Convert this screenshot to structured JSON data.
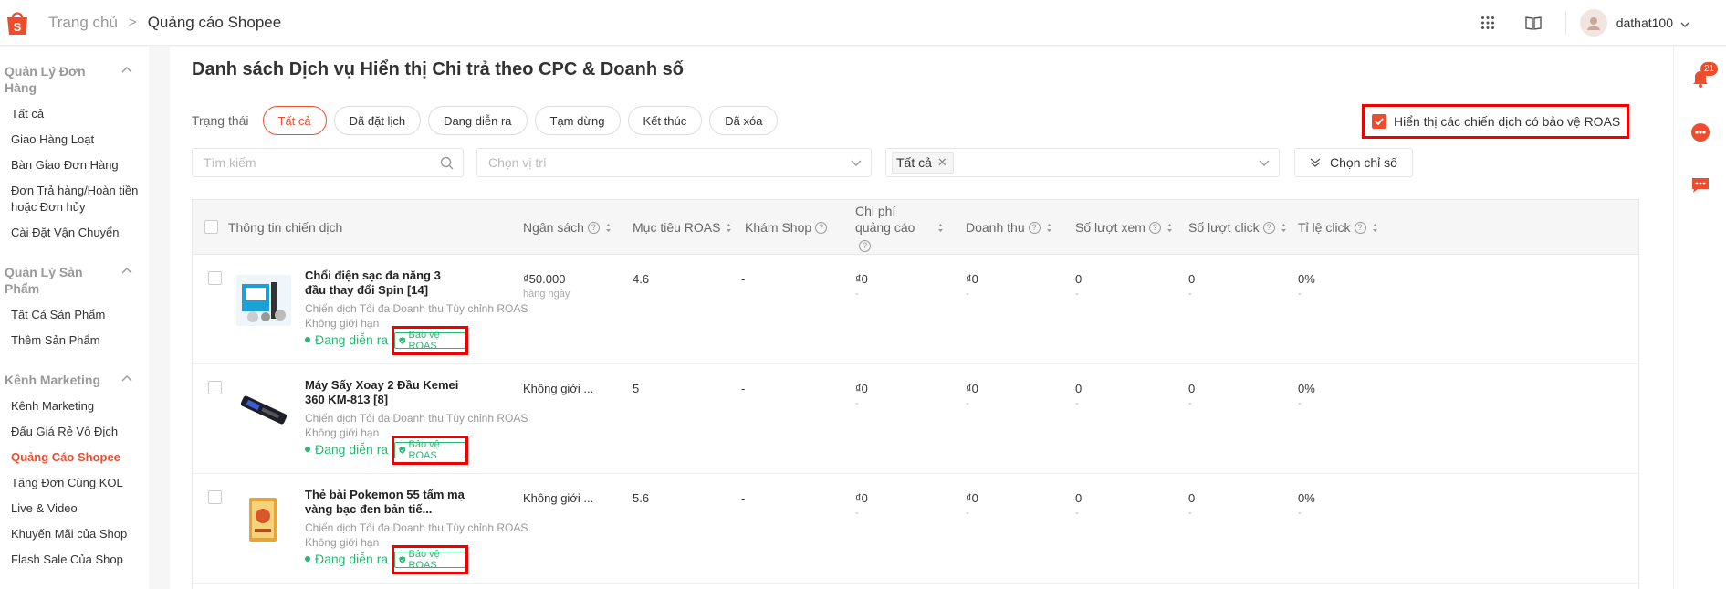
{
  "breadcrumb": {
    "home": "Trang chủ",
    "separator": ">",
    "current": "Quảng cáo Shopee"
  },
  "header": {
    "username": "dathat100",
    "notification_count": "21"
  },
  "sidebar": {
    "groups": [
      {
        "title": "Quản Lý Đơn Hàng",
        "items": [
          "Tất cả",
          "Giao Hàng Loạt",
          "Bàn Giao Đơn Hàng",
          "Đơn Trả hàng/Hoàn tiền hoặc Đơn hủy",
          "Cài Đặt Vận Chuyển"
        ]
      },
      {
        "title": "Quản Lý Sản Phẩm",
        "items": [
          "Tất Cả Sản Phẩm",
          "Thêm Sản Phẩm"
        ]
      },
      {
        "title": "Kênh Marketing",
        "items": [
          "Kênh Marketing",
          "Đấu Giá Rẻ Vô Địch",
          "Quảng Cáo Shopee",
          "Tăng Đơn Cùng KOL",
          "Live & Video",
          "Khuyến Mãi của Shop",
          "Flash Sale Của Shop"
        ]
      }
    ],
    "active_item": "Quảng Cáo Shopee"
  },
  "page": {
    "title": "Danh sách Dịch vụ Hiển thị Chi trả theo CPC & Doanh số"
  },
  "status_filter": {
    "label": "Trạng thái",
    "chips": [
      "Tất cả",
      "Đã đặt lịch",
      "Đang diễn ra",
      "Tạm dừng",
      "Kết thúc",
      "Đã xóa"
    ],
    "active": "Tất cả"
  },
  "roas_toggle": {
    "label": "Hiển thị các chiến dịch có bảo vệ ROAS",
    "checked": true
  },
  "filters": {
    "search_placeholder": "Tìm kiếm",
    "position_placeholder": "Chọn vị trí",
    "selected_tag": "Tất cả",
    "metric_button": "Chọn chỉ số"
  },
  "table": {
    "columns": [
      "Thông tin chiến dịch",
      "Ngân sách",
      "Mục tiêu ROAS",
      "Khám Shop",
      "Chi phí quảng cáo",
      "Doanh thu",
      "Số lượt xem",
      "Số lượt click",
      "Tỉ lệ click"
    ],
    "rows": [
      {
        "name": "Chổi điện sạc đa năng 3 đầu thay đổi Spin [14]",
        "type": "Chiến dịch Tối đa Doanh thu Tùy chỉnh ROAS",
        "limit": "Không giới hạn",
        "status": "Đang diễn ra",
        "badge": "Bảo vệ ROAS",
        "budget": "₫50.000",
        "budget_sub": "hàng ngày",
        "roas": "4.6",
        "shop_visit": "-",
        "cost": "₫0",
        "cost_sub": "-",
        "revenue": "₫0",
        "revenue_sub": "-",
        "views": "0",
        "views_sub": "-",
        "clicks": "0",
        "clicks_sub": "-",
        "ctr": "0%",
        "ctr_sub": "-"
      },
      {
        "name": "Máy Sấy Xoay 2 Đầu Kemei 360 KM-813 [8]",
        "type": "Chiến dịch Tối đa Doanh thu Tùy chỉnh ROAS",
        "limit": "Không giới hạn",
        "status": "Đang diễn ra",
        "badge": "Bảo vệ ROAS",
        "budget": "Không giới ...",
        "budget_sub": "",
        "roas": "5",
        "shop_visit": "-",
        "cost": "₫0",
        "cost_sub": "-",
        "revenue": "₫0",
        "revenue_sub": "-",
        "views": "0",
        "views_sub": "-",
        "clicks": "0",
        "clicks_sub": "-",
        "ctr": "0%",
        "ctr_sub": "-"
      },
      {
        "name": "Thẻ bài Pokemon 55 tấm mạ vàng bạc đen bản tiế...",
        "type": "Chiến dịch Tối đa Doanh thu Tùy chỉnh ROAS",
        "limit": "Không giới hạn",
        "status": "Đang diễn ra",
        "badge": "Bảo vệ ROAS",
        "budget": "Không giới ...",
        "budget_sub": "",
        "roas": "5.6",
        "shop_visit": "-",
        "cost": "₫0",
        "cost_sub": "-",
        "revenue": "₫0",
        "revenue_sub": "-",
        "views": "0",
        "views_sub": "-",
        "clicks": "0",
        "clicks_sub": "-",
        "ctr": "0%",
        "ctr_sub": "-"
      }
    ]
  },
  "colors": {
    "accent": "#ee4d2d",
    "success": "#2bb673",
    "highlight_box": "#e00000"
  }
}
